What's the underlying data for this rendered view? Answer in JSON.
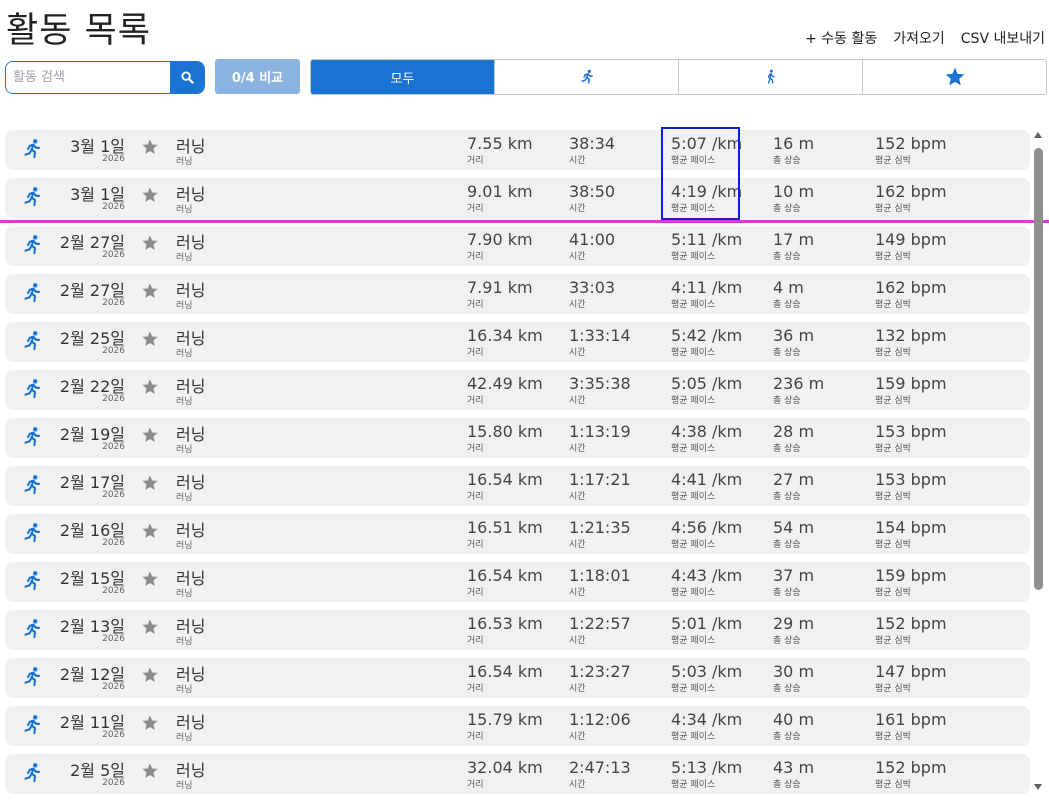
{
  "title": "활동 목록",
  "actions": {
    "manual": "+ 수동 활동",
    "import": "가져오기",
    "export": "CSV 내보내기"
  },
  "search": {
    "placeholder": "활동 검색",
    "value": ""
  },
  "compare_label": "0/4 비교",
  "tabs": [
    {
      "label": "모두",
      "icon": "",
      "active": true
    },
    {
      "label": "",
      "icon": "running-icon",
      "active": false
    },
    {
      "label": "",
      "icon": "walking-icon",
      "active": false
    },
    {
      "label": "",
      "icon": "star-icon",
      "active": false
    }
  ],
  "colors": {
    "accent": "#1a73d1",
    "compare_disabled": "#8ab3e0",
    "row_bg": "#f1f1f1",
    "activity_icon": "#1a73d1",
    "star_gray": "#8a8a8a",
    "highlight": "#0b1fd6",
    "divider": "#d23fd6"
  },
  "labels": {
    "distance": "거리",
    "time": "시간",
    "pace": "평균 페이스",
    "ascent": "총 상승",
    "hr": "평균 심박"
  },
  "activities": [
    {
      "day": "3월 1일",
      "year": "2026",
      "name": "러닝",
      "type": "러닝",
      "distance": "7.55 km",
      "time": "38:34",
      "pace": "5:07 /km",
      "ascent": "16 m",
      "hr": "152 bpm"
    },
    {
      "day": "3월 1일",
      "year": "2026",
      "name": "러닝",
      "type": "러닝",
      "distance": "9.01 km",
      "time": "38:50",
      "pace": "4:19 /km",
      "ascent": "10 m",
      "hr": "162 bpm"
    },
    {
      "day": "2월 27일",
      "year": "2026",
      "name": "러닝",
      "type": "러닝",
      "distance": "7.90 km",
      "time": "41:00",
      "pace": "5:11 /km",
      "ascent": "17 m",
      "hr": "149 bpm"
    },
    {
      "day": "2월 27일",
      "year": "2026",
      "name": "러닝",
      "type": "러닝",
      "distance": "7.91 km",
      "time": "33:03",
      "pace": "4:11 /km",
      "ascent": "4 m",
      "hr": "162 bpm"
    },
    {
      "day": "2월 25일",
      "year": "2026",
      "name": "러닝",
      "type": "러닝",
      "distance": "16.34 km",
      "time": "1:33:14",
      "pace": "5:42 /km",
      "ascent": "36 m",
      "hr": "132 bpm"
    },
    {
      "day": "2월 22일",
      "year": "2026",
      "name": "러닝",
      "type": "러닝",
      "distance": "42.49 km",
      "time": "3:35:38",
      "pace": "5:05 /km",
      "ascent": "236 m",
      "hr": "159 bpm"
    },
    {
      "day": "2월 19일",
      "year": "2026",
      "name": "러닝",
      "type": "러닝",
      "distance": "15.80 km",
      "time": "1:13:19",
      "pace": "4:38 /km",
      "ascent": "28 m",
      "hr": "153 bpm"
    },
    {
      "day": "2월 17일",
      "year": "2026",
      "name": "러닝",
      "type": "러닝",
      "distance": "16.54 km",
      "time": "1:17:21",
      "pace": "4:41 /km",
      "ascent": "27 m",
      "hr": "153 bpm"
    },
    {
      "day": "2월 16일",
      "year": "2026",
      "name": "러닝",
      "type": "러닝",
      "distance": "16.51 km",
      "time": "1:21:35",
      "pace": "4:56 /km",
      "ascent": "54 m",
      "hr": "154 bpm"
    },
    {
      "day": "2월 15일",
      "year": "2026",
      "name": "러닝",
      "type": "러닝",
      "distance": "16.54 km",
      "time": "1:18:01",
      "pace": "4:43 /km",
      "ascent": "37 m",
      "hr": "159 bpm"
    },
    {
      "day": "2월 13일",
      "year": "2026",
      "name": "러닝",
      "type": "러닝",
      "distance": "16.53 km",
      "time": "1:22:57",
      "pace": "5:01 /km",
      "ascent": "29 m",
      "hr": "152 bpm"
    },
    {
      "day": "2월 12일",
      "year": "2026",
      "name": "러닝",
      "type": "러닝",
      "distance": "16.54 km",
      "time": "1:23:27",
      "pace": "5:03 /km",
      "ascent": "30 m",
      "hr": "147 bpm"
    },
    {
      "day": "2월 11일",
      "year": "2026",
      "name": "러닝",
      "type": "러닝",
      "distance": "15.79 km",
      "time": "1:12:06",
      "pace": "4:34 /km",
      "ascent": "40 m",
      "hr": "161 bpm"
    },
    {
      "day": "2월 5일",
      "year": "2026",
      "name": "러닝",
      "type": "러닝",
      "distance": "32.04 km",
      "time": "2:47:13",
      "pace": "5:13 /km",
      "ascent": "43 m",
      "hr": "152 bpm"
    }
  ]
}
